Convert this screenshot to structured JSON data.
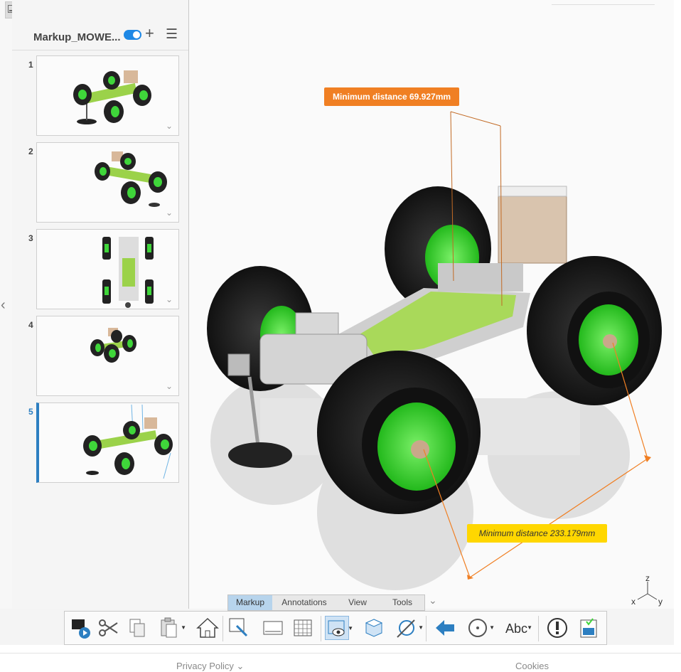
{
  "panel": {
    "title": "Markup_MOWE...",
    "items": [
      {
        "num": "1"
      },
      {
        "num": "2"
      },
      {
        "num": "3"
      },
      {
        "num": "4"
      },
      {
        "num": "5",
        "active": true
      }
    ]
  },
  "viewport": {
    "measurement_top": "Minimum distance 69.927mm",
    "measurement_bottom": "Minimum distance 233.179mm",
    "triad": {
      "z": "z",
      "x": "x",
      "y": "y"
    }
  },
  "tabs": [
    "Markup",
    "Annotations",
    "View",
    "Tools"
  ],
  "active_tab": "Markup",
  "ribbon": {
    "text_tool_label": "Abc",
    "icons": [
      "present-icon",
      "cut-icon",
      "copy-icon",
      "paste-icon",
      "home-icon",
      "select-tool-icon",
      "panel-icon",
      "grid-icon",
      "view-icon",
      "cube-icon",
      "measure-icon",
      "back-arrow-icon",
      "orbit-icon",
      "text-tool-icon",
      "alert-icon",
      "certificate-icon"
    ]
  },
  "footer": {
    "privacy": "Privacy Policy ⌄",
    "cookies": "Cookies"
  },
  "colors": {
    "accent": "#2d7fc1",
    "orange": "#f07f23",
    "yellow": "#ffd700",
    "wheel_green": "#3fd63a"
  }
}
